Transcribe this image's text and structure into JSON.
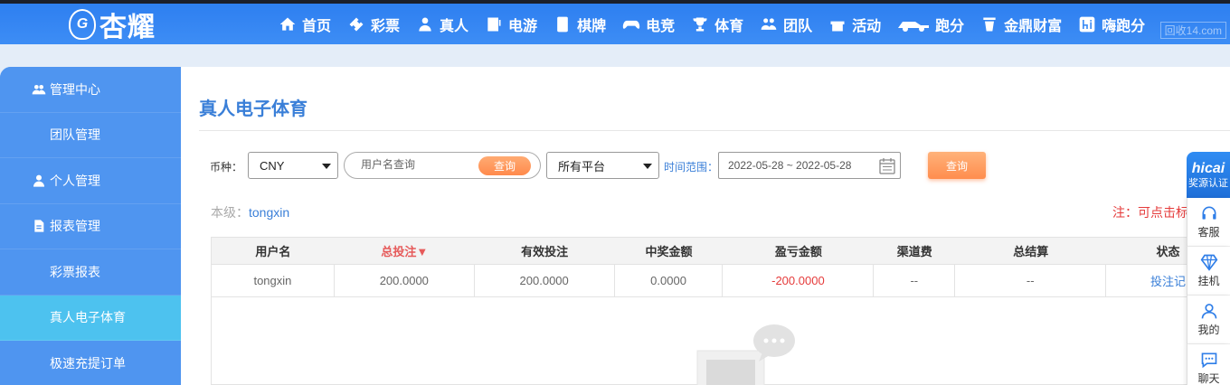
{
  "brand": {
    "logo_text": "杏耀",
    "badge_letter": "G"
  },
  "nav": [
    {
      "label": "首页",
      "icon": "home-icon"
    },
    {
      "label": "彩票",
      "icon": "ticket-icon"
    },
    {
      "label": "真人",
      "icon": "live-dealer-icon"
    },
    {
      "label": "电游",
      "icon": "slot-machine-icon"
    },
    {
      "label": "棋牌",
      "icon": "cards-icon"
    },
    {
      "label": "电竞",
      "icon": "gamepad-icon"
    },
    {
      "label": "体育",
      "icon": "trophy-icon"
    },
    {
      "label": "团队",
      "icon": "team-icon"
    },
    {
      "label": "活动",
      "icon": "gift-icon"
    },
    {
      "label": "跑分",
      "icon": "race-car-icon"
    },
    {
      "label": "金鼎财富",
      "icon": "wealth-icon"
    },
    {
      "label": "嗨跑分",
      "icon": "hi-icon"
    }
  ],
  "watermark": "回收14.com",
  "sidebar": {
    "items": [
      {
        "label": "管理中心",
        "type": "group",
        "icon": "users-icon"
      },
      {
        "label": "团队管理",
        "type": "item"
      },
      {
        "label": "个人管理",
        "type": "group",
        "icon": "user-icon"
      },
      {
        "label": "报表管理",
        "type": "group",
        "icon": "report-icon"
      },
      {
        "label": "彩票报表",
        "type": "item"
      },
      {
        "label": "真人电子体育",
        "type": "item",
        "active": true
      },
      {
        "label": "极速充提订单",
        "type": "item"
      }
    ]
  },
  "page": {
    "title": "真人电子体育"
  },
  "filters": {
    "currency_label": "币种：",
    "currency_value": "CNY",
    "username_placeholder": "用户名查询",
    "search_button": "查询",
    "platform_value": "所有平台",
    "time_label": "时间范围：",
    "date_range": "2022-05-28 ~ 2022-05-28",
    "query_button": "查询"
  },
  "level": {
    "label": "本级：",
    "username": "tongxin"
  },
  "note": "注：可点击标",
  "table": {
    "headers": [
      "用户名",
      "总投注▼",
      "有效投注",
      "中奖金额",
      "盈亏金额",
      "渠道费",
      "总结算",
      "状态"
    ],
    "rows": [
      [
        "tongxin",
        "200.0000",
        "200.0000",
        "0.0000",
        "-200.0000",
        "--",
        "--",
        "投注记"
      ]
    ]
  },
  "float_bar": {
    "top_big": "hicai",
    "top_small": "奖源认证",
    "items": [
      {
        "label": "客服",
        "icon": "headset-icon"
      },
      {
        "label": "挂机",
        "icon": "diamond-icon"
      },
      {
        "label": "我的",
        "icon": "profile-icon"
      },
      {
        "label": "聊天",
        "icon": "chat-icon"
      }
    ]
  },
  "colors": {
    "nav_bg": "#3d8df5",
    "sidebar_bg": "#4f95f0",
    "sidebar_active": "#4dc2ef",
    "accent_orange": "#ff8d4e",
    "negative": "#e53b3b"
  }
}
